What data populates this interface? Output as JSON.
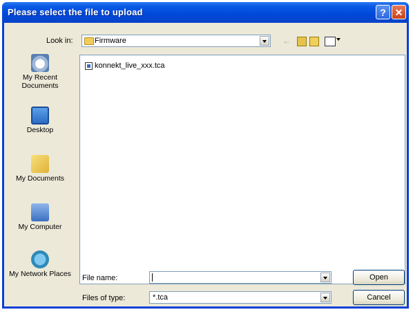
{
  "window": {
    "title": "Please select the file to upload",
    "help_glyph": "?",
    "close_glyph": "✕"
  },
  "toolbar": {
    "look_in_label": "Look in:",
    "look_in_value": "Firmware",
    "icons": [
      "back-icon",
      "up-folder-icon",
      "new-folder-icon",
      "views-icon"
    ]
  },
  "places": [
    {
      "label": "My Recent Documents",
      "icon": "recent-documents-icon"
    },
    {
      "label": "Desktop",
      "icon": "desktop-icon"
    },
    {
      "label": "My Documents",
      "icon": "my-documents-icon"
    },
    {
      "label": "My Computer",
      "icon": "my-computer-icon"
    },
    {
      "label": "My Network Places",
      "icon": "network-places-icon"
    }
  ],
  "files": [
    {
      "name": "konnekt_live_xxx.tca"
    }
  ],
  "form": {
    "file_name_label": "File name:",
    "file_name_value": "",
    "files_of_type_label": "Files of type:",
    "files_of_type_value": "*.tca"
  },
  "buttons": {
    "open": "Open",
    "cancel": "Cancel"
  }
}
